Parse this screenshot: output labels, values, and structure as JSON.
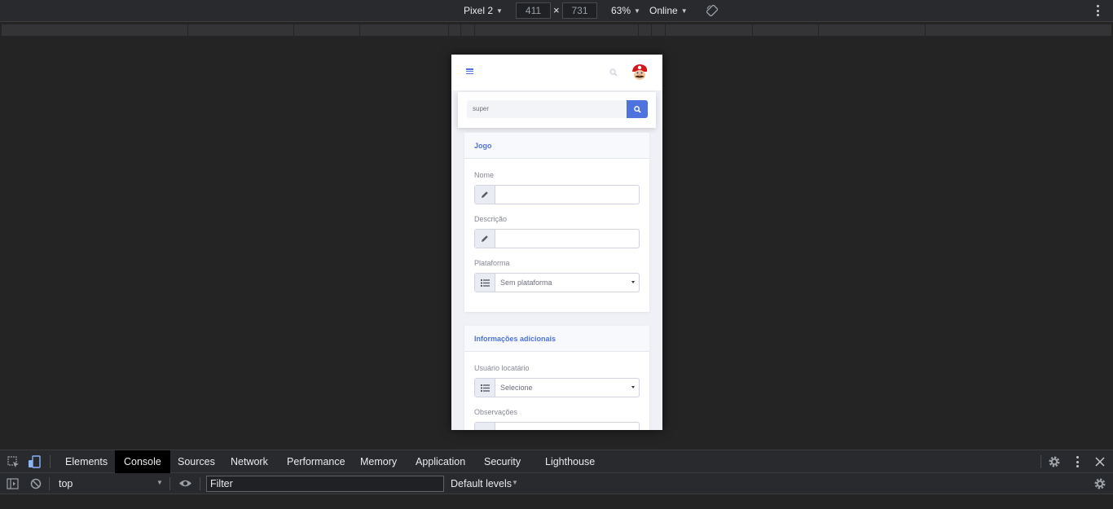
{
  "device_toolbar": {
    "device": "Pixel 2",
    "width": "411",
    "height": "731",
    "zoom": "63%",
    "network": "Online"
  },
  "app": {
    "search_value": "super",
    "game_card": {
      "title": "Jogo",
      "name_label": "Nome",
      "name_value": "",
      "description_label": "Descrição",
      "description_value": "",
      "platform_label": "Plataforma",
      "platform_selected": "Sem plataforma"
    },
    "extra_card": {
      "title": "Informações adicionais",
      "user_label": "Usuário locatário",
      "user_selected": "Selecione",
      "notes_label": "Observações"
    }
  },
  "devtools": {
    "tabs": [
      "Elements",
      "Console",
      "Sources",
      "Network",
      "Performance",
      "Memory",
      "Application",
      "Security",
      "Lighthouse"
    ],
    "active_tab": "Console",
    "context": "top",
    "filter_placeholder": "Filter",
    "levels": "Default levels"
  },
  "colors": {
    "accent": "#4e73df",
    "devtools_bg": "#242424"
  }
}
